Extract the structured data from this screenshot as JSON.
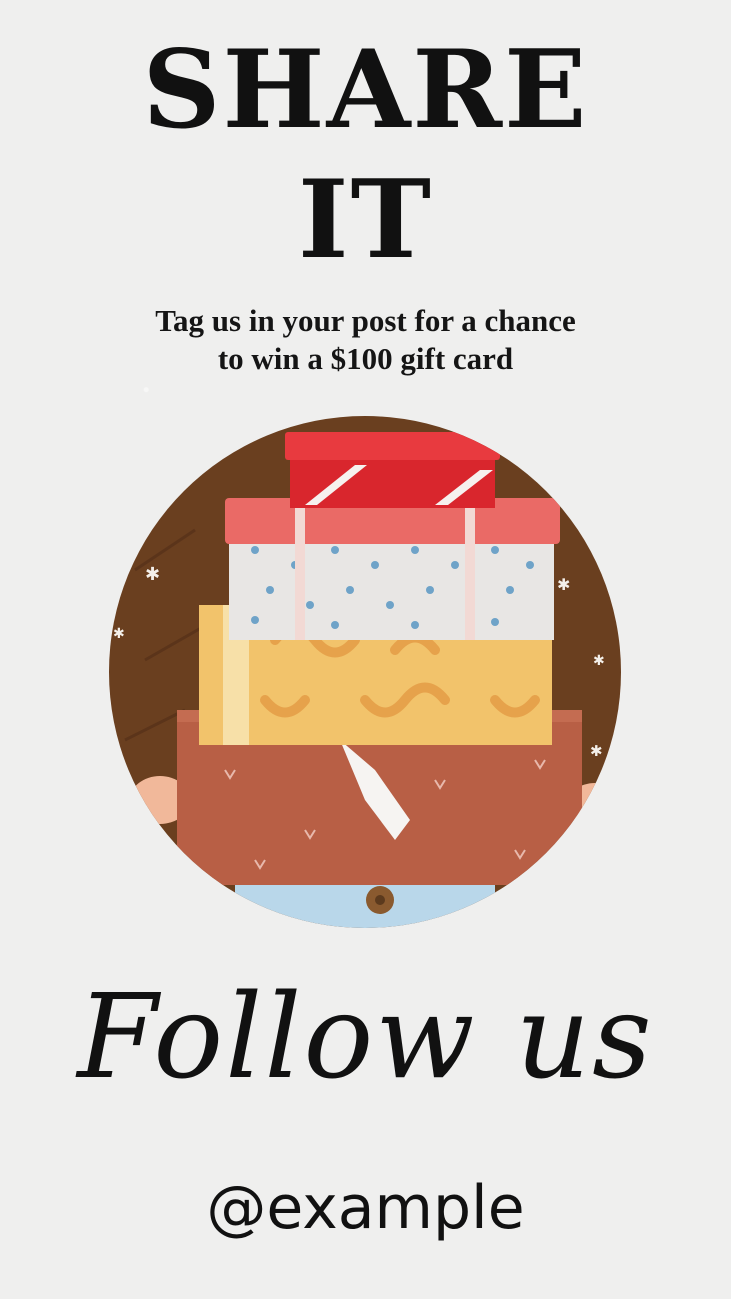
{
  "headline": {
    "line1": "SHARE",
    "line2": "IT"
  },
  "subtitle": {
    "line1": "Tag us in your post for a chance",
    "line2": "to win a $100 gift card"
  },
  "illustration": {
    "icon": "stacked-gift-boxes-icon"
  },
  "follow": {
    "label": "Follow us",
    "handle": "@example"
  },
  "colors": {
    "background": "#efefee",
    "text": "#111111",
    "circle_bg": "#6a3f1f",
    "red_box": "#d9262d",
    "pink_lid": "#ea6a66",
    "white_box": "#e8e6e4",
    "dot_blue": "#6fa3c8",
    "yellow_box": "#f2c36b",
    "brown_box": "#b85f45",
    "jeans": "#b9d7ea"
  }
}
